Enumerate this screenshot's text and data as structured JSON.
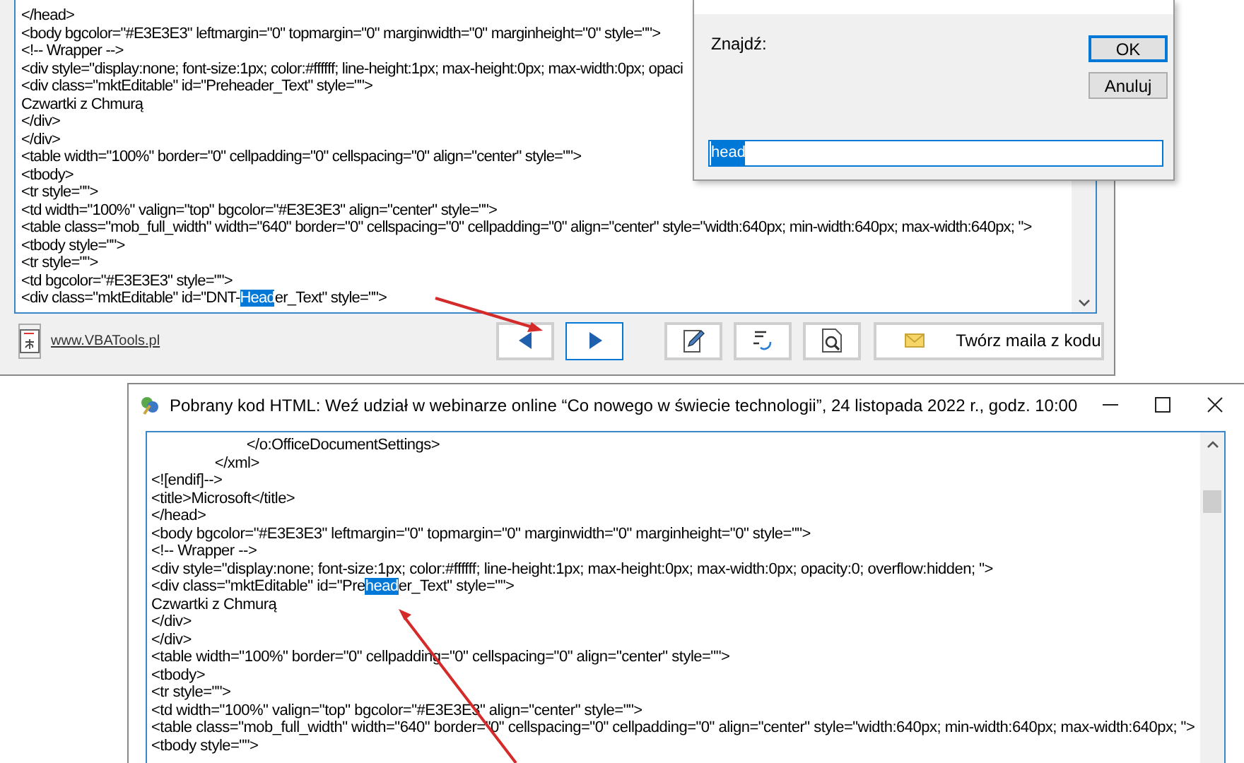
{
  "source_window": {
    "lines": [
      {
        "text": "</head>"
      },
      {
        "text": "<body bgcolor=\"#E3E3E3\" leftmargin=\"0\" topmargin=\"0\" marginwidth=\"0\" marginheight=\"0\" style=\"\">"
      },
      {
        "text": "<!-- Wrapper -->"
      },
      {
        "text": "<div style=\"display:none; font-size:1px; color:#ffffff; line-height:1px; max-height:0px; max-width:0px; opaci"
      },
      {
        "text": "<div class=\"mktEditable\" id=\"Preheader_Text\" style=\"\">"
      },
      {
        "text": "Czwartki z Chmurą"
      },
      {
        "text": "</div>"
      },
      {
        "text": "</div>"
      },
      {
        "text": "<table width=\"100%\" border=\"0\" cellpadding=\"0\" cellspacing=\"0\" align=\"center\" style=\"\">"
      },
      {
        "text": "<tbody>"
      },
      {
        "text": "<tr style=\"\">"
      },
      {
        "text": "<td width=\"100%\" valign=\"top\" bgcolor=\"#E3E3E3\" align=\"center\" style=\"\">"
      },
      {
        "text": "<table class=\"mob_full_width\" width=\"640\" border=\"0\" cellspacing=\"0\" cellpadding=\"0\" align=\"center\" style=\"width:640px; min-width:640px; max-width:640px; \">"
      },
      {
        "text": "<tbody style=\"\">"
      },
      {
        "text": "<tr style=\"\">"
      },
      {
        "text": "<td bgcolor=\"#E3E3E3\" style=\"\">"
      },
      {
        "before": "<div class=\"mktEditable\" id=\"DNT-",
        "match": "Head",
        "after": "er_Text\" style=\"\">"
      }
    ],
    "link": "www.VBATools.pl",
    "nav_buttons": [
      {
        "kind": "prev",
        "focused": false
      },
      {
        "kind": "next",
        "focused": true
      }
    ],
    "tool_buttons": [
      {
        "kind": "edit"
      },
      {
        "kind": "replace"
      },
      {
        "kind": "preview"
      }
    ],
    "create_button": {
      "label": "Twórz maila z kodu"
    }
  },
  "find_dialog": {
    "label": "Znajdź:",
    "buttons": [
      {
        "label": "OK",
        "focused": true
      },
      {
        "label": "Anuluj",
        "focused": false
      }
    ],
    "value": "head"
  },
  "result_window": {
    "title": "Pobrany kod HTML: Weź udział w webinarze online “Co nowego w świecie technologii”, 24 listopada 2022 r., godz. 10:00",
    "lines": [
      {
        "text": "                        </o:OfficeDocumentSettings>"
      },
      {
        "text": "                </xml>"
      },
      {
        "text": "<![endif]-->"
      },
      {
        "text": "<title>Microsoft</title>"
      },
      {
        "text": "</head>"
      },
      {
        "text": "<body bgcolor=\"#E3E3E3\" leftmargin=\"0\" topmargin=\"0\" marginwidth=\"0\" marginheight=\"0\" style=\"\">"
      },
      {
        "text": "<!-- Wrapper -->"
      },
      {
        "text": "<div style=\"display:none; font-size:1px; color:#ffffff; line-height:1px; max-height:0px; max-width:0px; opacity:0; overflow:hidden; \">"
      },
      {
        "before": "<div class=\"mktEditable\" id=\"Pre",
        "match": "head",
        "after": "er_Text\" style=\"\">"
      },
      {
        "text": "Czwartki z Chmurą"
      },
      {
        "text": "</div>"
      },
      {
        "text": "</div>"
      },
      {
        "text": "<table width=\"100%\" border=\"0\" cellpadding=\"0\" cellspacing=\"0\" align=\"center\" style=\"\">"
      },
      {
        "text": "<tbody>"
      },
      {
        "text": "<tr style=\"\">"
      },
      {
        "text": "<td width=\"100%\" valign=\"top\" bgcolor=\"#E3E3E3\" align=\"center\" style=\"\">"
      },
      {
        "text": "<table class=\"mob_full_width\" width=\"640\" border=\"0\" cellspacing=\"0\" cellpadding=\"0\" align=\"center\" style=\"width:640px; min-width:640px; max-width:640px; \">"
      },
      {
        "text": "<tbody style=\"\">"
      }
    ]
  }
}
